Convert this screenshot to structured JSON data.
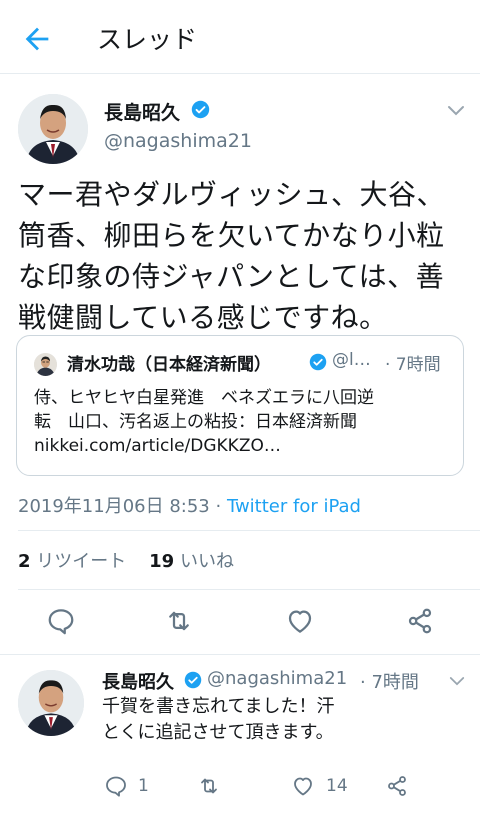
{
  "header": {
    "title": "スレッド"
  },
  "tweet": {
    "author_name": "長島昭久",
    "handle": "@nagashima21",
    "text_lines": [
      "マー君やダルヴィッシュ、大谷、",
      "筒香、柳田らを欠いてかなり小粒",
      "な印象の侍ジャパンとしては、善",
      "戦健闘している感じですね。"
    ],
    "quote": {
      "author_name": "清水功哉（日本経済新聞）",
      "handle": "@l…",
      "time": "· 7時間",
      "text_lines": [
        "侍、ヒヤヒヤ白星発進　ベネズエラに八回逆",
        "転　山口、汚名返上の粘投：日本経済新聞",
        "nikkei.com/article/DGKKZO…"
      ]
    },
    "timestamp": "2019年11月06日 8:53",
    "separator": " · ",
    "source": "Twitter for iPad",
    "retweet_count": "2",
    "retweet_label": "リツイート",
    "like_count": "19",
    "like_label": "いいね"
  },
  "reply": {
    "author_name": "長島昭久",
    "handle": "@nagashima21",
    "time": "· 7時間",
    "text_lines": [
      "千賀を書き忘れてました！汗",
      "とくに追記させて頂きます。"
    ],
    "reply_count": "1",
    "like_count": "14"
  },
  "colors": {
    "accent": "#1da1f2",
    "secondary_text": "#657786",
    "border": "#e6ecf0"
  },
  "icons": {
    "back": "arrow-left-icon",
    "verified": "verified-badge-icon",
    "reply": "reply-icon",
    "retweet": "retweet-icon",
    "like": "heart-icon",
    "share": "share-icon",
    "more": "chevron-down-icon"
  }
}
